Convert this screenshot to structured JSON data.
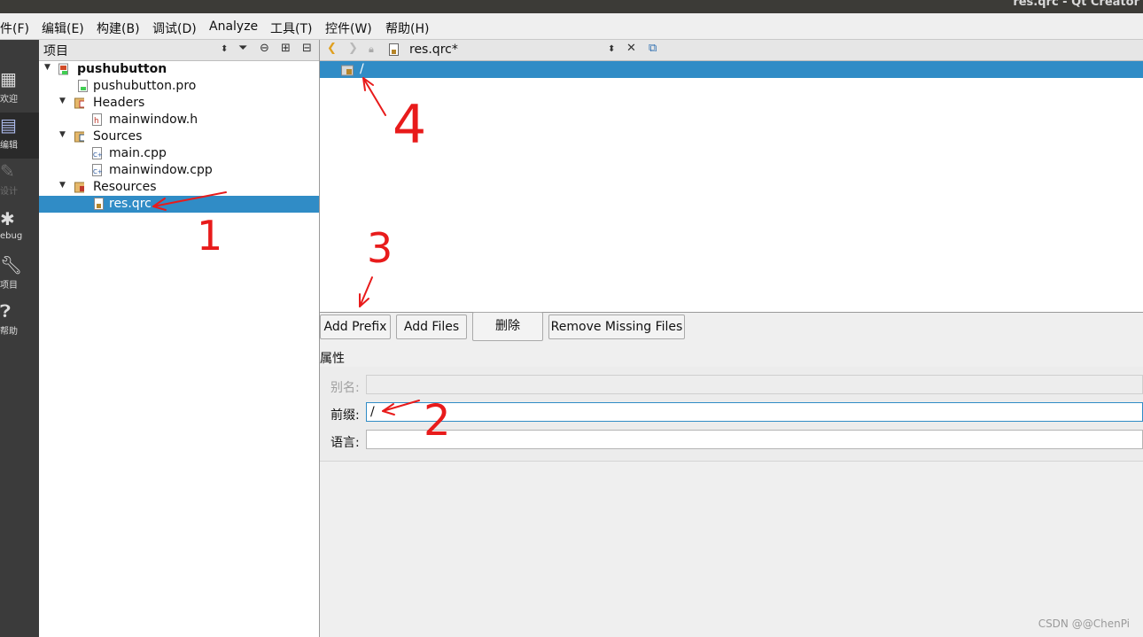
{
  "window": {
    "title": "res.qrc - Qt Creator"
  },
  "menu": [
    "件(F)",
    "编辑(E)",
    "构建(B)",
    "调试(D)",
    "Analyze",
    "工具(T)",
    "控件(W)",
    "帮助(H)"
  ],
  "modes": [
    {
      "label": "欢迎",
      "icon": "grid-icon"
    },
    {
      "label": "编辑",
      "icon": "edit-icon"
    },
    {
      "label": "设计",
      "icon": "pencil-icon"
    },
    {
      "label": "ebug",
      "icon": "bug-icon"
    },
    {
      "label": "项目",
      "icon": "wrench-icon"
    },
    {
      "label": "帮助",
      "icon": "help-icon"
    }
  ],
  "project_panel": {
    "title": "项目",
    "tree": [
      {
        "label": "pushubutton",
        "icon": "qt-project-icon"
      },
      {
        "label": "pushubutton.pro",
        "icon": "pro-file-icon"
      },
      {
        "label": "Headers",
        "icon": "folder-headers-icon"
      },
      {
        "label": "mainwindow.h",
        "icon": "header-file-icon"
      },
      {
        "label": "Sources",
        "icon": "folder-sources-icon"
      },
      {
        "label": "main.cpp",
        "icon": "cpp-file-icon"
      },
      {
        "label": "mainwindow.cpp",
        "icon": "cpp-file-icon"
      },
      {
        "label": "Resources",
        "icon": "folder-resources-icon"
      },
      {
        "label": "res.qrc",
        "icon": "qrc-file-icon"
      }
    ]
  },
  "editor": {
    "document": "res.qrc*",
    "resource_tree": [
      {
        "label": "/"
      }
    ],
    "buttons": {
      "add_prefix": "Add Prefix",
      "add_files": "Add Files",
      "delete": "删除",
      "remove_missing": "Remove Missing Files"
    },
    "properties": {
      "title": "属性",
      "alias_label": "别名:",
      "alias_value": "",
      "prefix_label": "前缀:",
      "prefix_value": "/",
      "language_label": "语言:",
      "language_value": ""
    }
  },
  "annotations": [
    "1",
    "2",
    "3",
    "4"
  ],
  "watermark": "CSDN @@ChenPi",
  "colors": {
    "selection": "#308cc6",
    "modebar": "#3b3b3b",
    "annotation": "#e81b1b"
  }
}
